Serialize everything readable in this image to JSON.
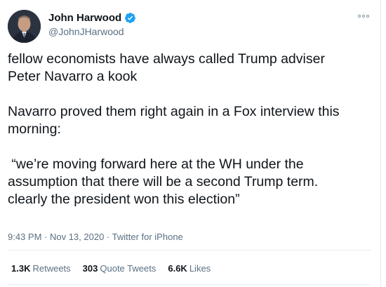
{
  "author": {
    "display_name": "John Harwood",
    "handle": "@JohnJHarwood",
    "verified": true
  },
  "tweet": {
    "text": "fellow economists have always called Trump adviser\nPeter Navarro a kook\n\nNavarro proved them right again in a Fox interview this\nmorning:\n\n “we’re moving forward here at the WH under the\nassumption that there will be a second Trump term.\nclearly the president won this election”",
    "meta": "9:43 PM · Nov 13, 2020 · Twitter for iPhone"
  },
  "stats": {
    "retweets_count": "1.3K",
    "retweets_label": "Retweets",
    "quotes_count": "303",
    "quotes_label": "Quote Tweets",
    "likes_count": "6.6K",
    "likes_label": "Likes"
  },
  "colors": {
    "verified": "#1da1f2",
    "secondary_text": "#5b7083",
    "primary_text": "#0f1419"
  }
}
